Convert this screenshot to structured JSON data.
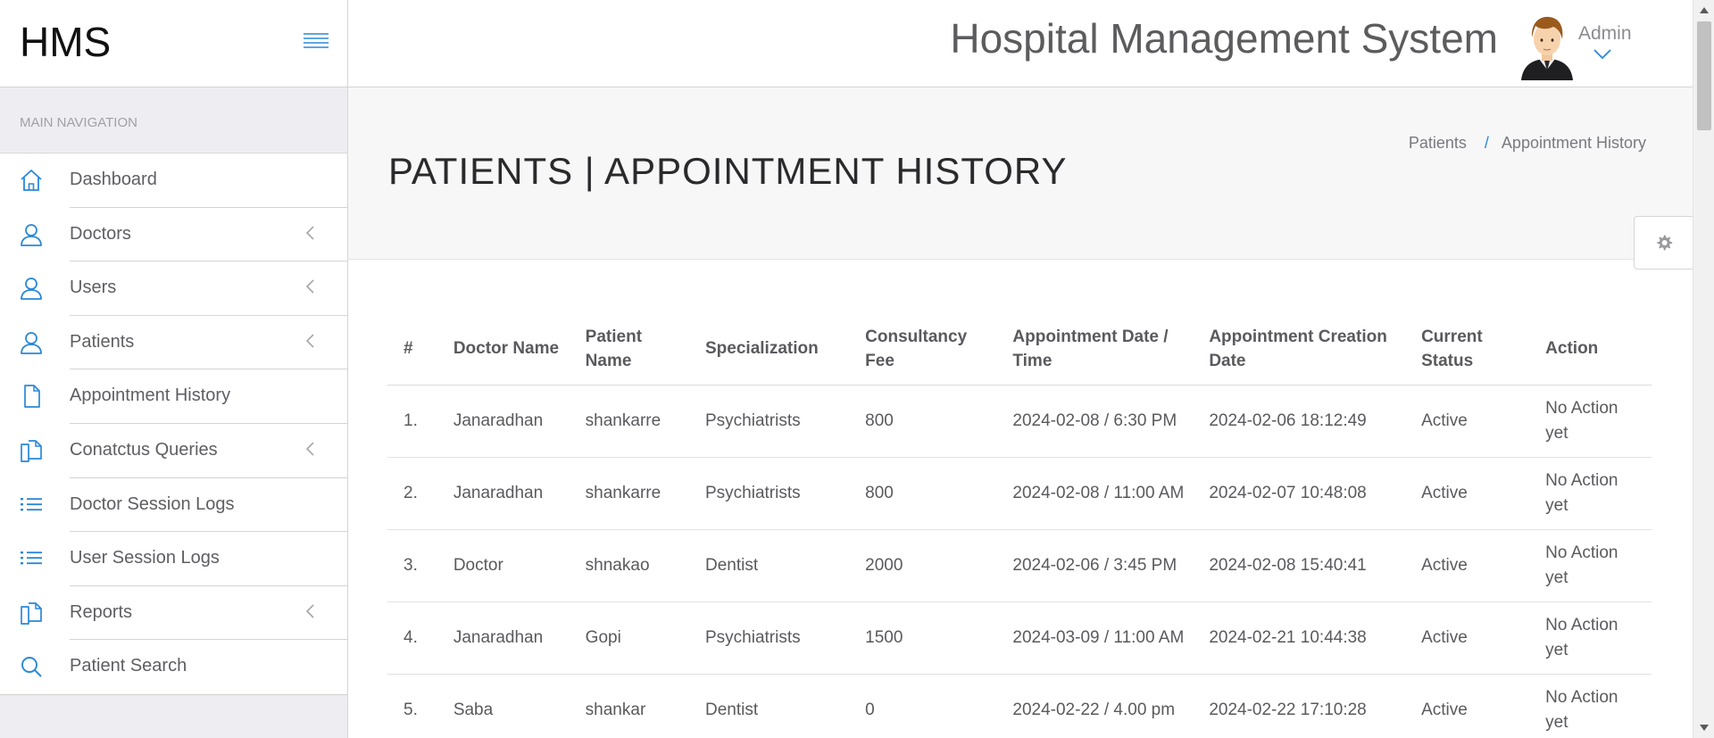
{
  "brand": {
    "name": "HMS"
  },
  "header": {
    "title": "Hospital Management System",
    "user_name": "Admin"
  },
  "sidebar": {
    "caption": "MAIN NAVIGATION",
    "items": [
      {
        "label": "Dashboard",
        "icon": "home-icon",
        "has_submenu": false
      },
      {
        "label": "Doctors",
        "icon": "user-icon",
        "has_submenu": true
      },
      {
        "label": "Users",
        "icon": "user-icon",
        "has_submenu": true
      },
      {
        "label": "Patients",
        "icon": "user-icon",
        "has_submenu": true
      },
      {
        "label": "Appointment History",
        "icon": "file-icon",
        "has_submenu": false
      },
      {
        "label": "Conatctus Queries",
        "icon": "files-icon",
        "has_submenu": true
      },
      {
        "label": "Doctor Session Logs",
        "icon": "list-icon",
        "has_submenu": false
      },
      {
        "label": "User Session Logs",
        "icon": "list-icon",
        "has_submenu": false
      },
      {
        "label": "Reports",
        "icon": "files-icon",
        "has_submenu": true
      },
      {
        "label": "Patient Search",
        "icon": "search-icon",
        "has_submenu": false
      }
    ]
  },
  "page": {
    "title": "PATIENTS | APPOINTMENT HISTORY",
    "breadcrumb": {
      "parent": "Patients",
      "separator": "/",
      "current": "Appointment History"
    }
  },
  "table": {
    "columns": [
      "#",
      "Doctor Name",
      "Patient Name",
      "Specialization",
      "Consultancy Fee",
      "Appointment Date / Time",
      "Appointment Creation Date",
      "Current Status",
      "Action"
    ],
    "rows": [
      [
        "1.",
        "Janaradhan",
        "shankarre",
        "Psychiatrists",
        "800",
        "2024-02-08 / 6:30 PM",
        "2024-02-06 18:12:49",
        "Active",
        "No Action yet"
      ],
      [
        "2.",
        "Janaradhan",
        "shankarre",
        "Psychiatrists",
        "800",
        "2024-02-08 / 11:00 AM",
        "2024-02-07 10:48:08",
        "Active",
        "No Action yet"
      ],
      [
        "3.",
        "Doctor",
        "shnakao",
        "Dentist",
        "2000",
        "2024-02-06 / 3:45 PM",
        "2024-02-08 15:40:41",
        "Active",
        "No Action yet"
      ],
      [
        "4.",
        "Janaradhan",
        "Gopi",
        "Psychiatrists",
        "1500",
        "2024-03-09 / 11:00 AM",
        "2024-02-21 10:44:38",
        "Active",
        "No Action yet"
      ],
      [
        "5.",
        "Saba",
        "shankar",
        "Dentist",
        "0",
        "2024-02-22 / 4.00 pm",
        "2024-02-22 17:10:28",
        "Active",
        "No Action yet"
      ]
    ]
  },
  "colors": {
    "accent": "#2a88d8",
    "sidebar_bg": "#eeeef2",
    "text": "#5a5a5e"
  }
}
